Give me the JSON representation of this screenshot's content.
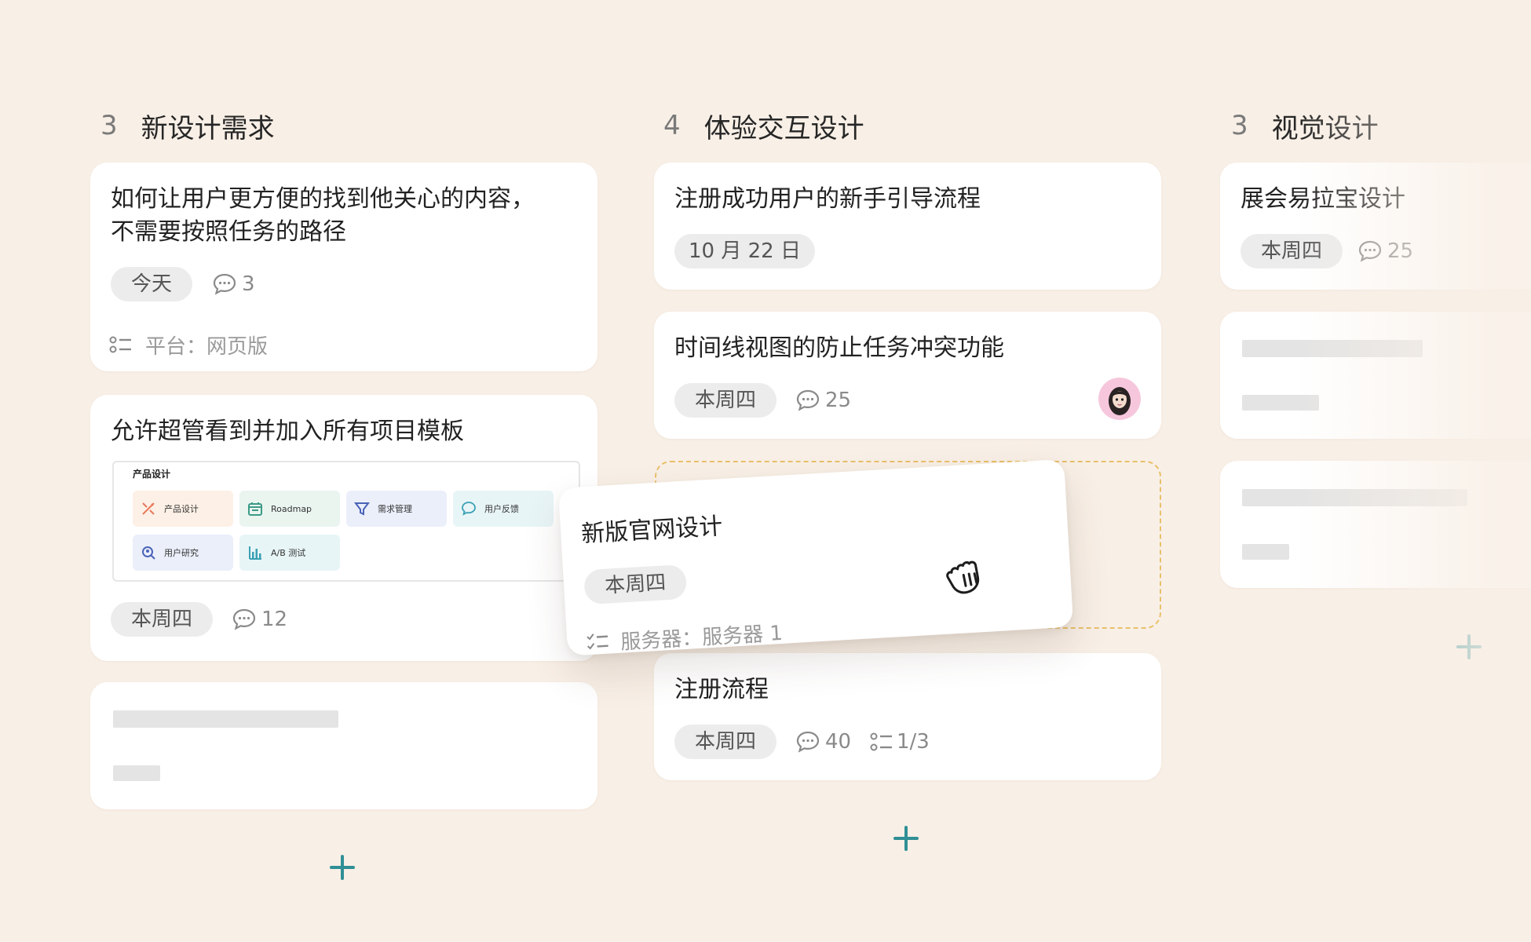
{
  "colors": {
    "background": "#f8efe6",
    "accent": "#2f8f95",
    "drop_border": "#e8c06a",
    "chip": "#ececec"
  },
  "columns": [
    {
      "count": "3",
      "title": "新设计需求",
      "cards": [
        {
          "title_line1": "如何让用户更方便的找到他关心的内容，",
          "title_line2": "不需要按照任务的路径",
          "chip": "今天",
          "comments": "3",
          "field": "平台：网页版"
        },
        {
          "title": "允许超管看到并加入所有项目模板",
          "chip": "本周四",
          "comments": "12",
          "template": {
            "title": "产品设计",
            "tiles": [
              {
                "label": "产品设计",
                "icon": "design-tools-icon"
              },
              {
                "label": "Roadmap",
                "icon": "calendar-icon"
              },
              {
                "label": "需求管理",
                "icon": "funnel-icon"
              },
              {
                "label": "用户反馈",
                "icon": "chat-bubble-icon"
              },
              {
                "label": "用户研究",
                "icon": "user-research-icon"
              },
              {
                "label": "A/B 测试",
                "icon": "bar-chart-icon"
              }
            ]
          }
        }
      ]
    },
    {
      "count": "4",
      "title": "体验交互设计",
      "cards": [
        {
          "title": "注册成功用户的新手引导流程",
          "chip": "10 月 22 日"
        },
        {
          "title": "时间线视图的防止任务冲突功能",
          "chip": "本周四",
          "comments": "25"
        },
        {
          "title": "注册流程",
          "chip": "本周四",
          "comments": "40",
          "subtasks": "1/3"
        }
      ]
    },
    {
      "count": "3",
      "title": "视觉设计",
      "cards": [
        {
          "title": "展会易拉宝设计",
          "chip": "本周四",
          "comments": "25"
        }
      ]
    }
  ],
  "dragging_card": {
    "title": "新版官网设计",
    "chip": "本周四",
    "field": "服务器：服务器 1"
  }
}
